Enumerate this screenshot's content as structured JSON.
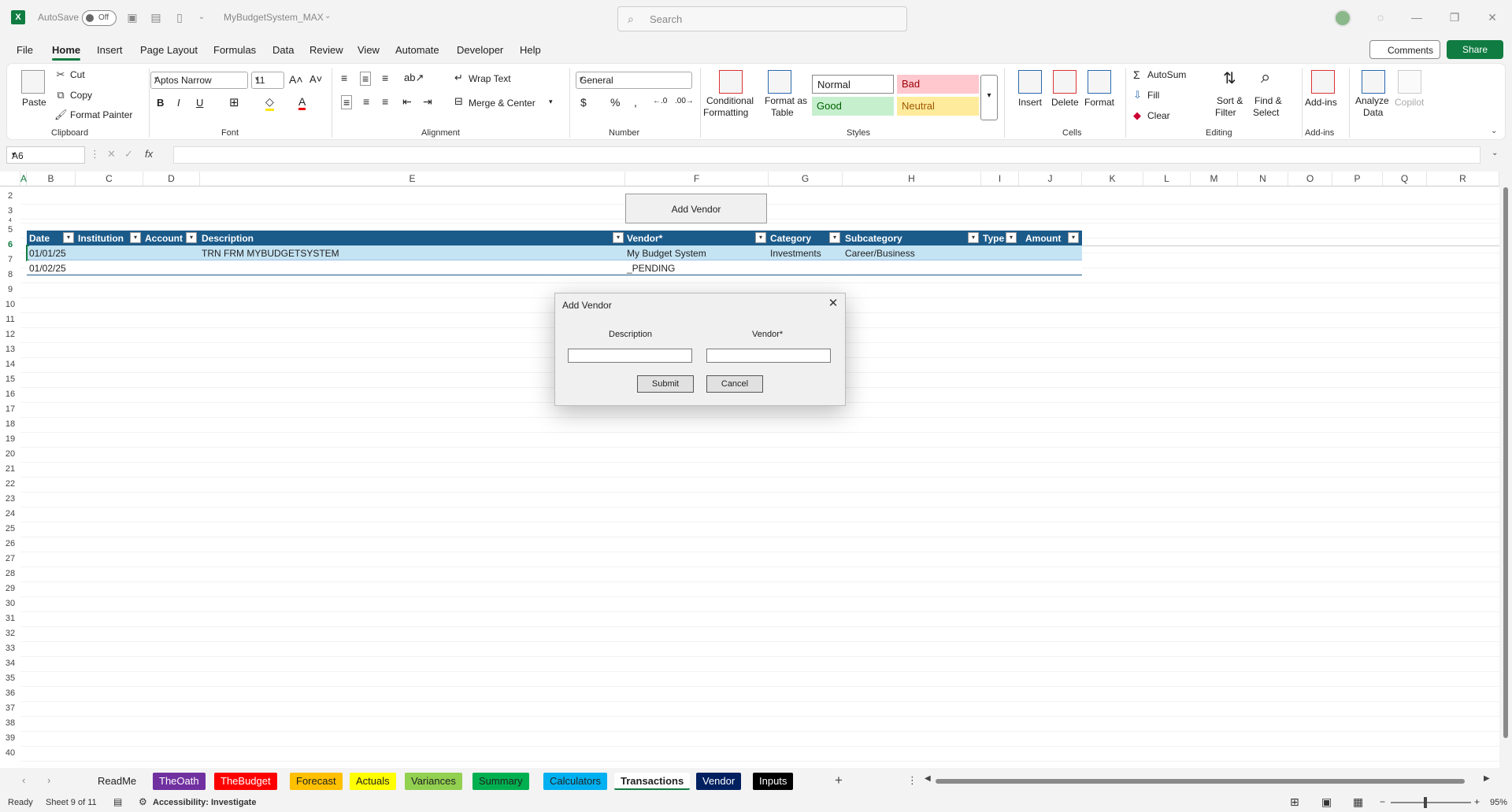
{
  "titlebar": {
    "autosave_label": "AutoSave",
    "autosave_state": "Off",
    "filename": "MyBudgetSystem_MAX",
    "search_placeholder": "Search"
  },
  "menu": {
    "items": [
      "File",
      "Home",
      "Insert",
      "Page Layout",
      "Formulas",
      "Data",
      "Review",
      "View",
      "Automate",
      "Developer",
      "Help"
    ],
    "active": "Home",
    "comments": "Comments",
    "share": "Share"
  },
  "ribbon": {
    "clipboard": {
      "paste": "Paste",
      "cut": "Cut",
      "copy": "Copy",
      "format_painter": "Format Painter",
      "label": "Clipboard"
    },
    "font": {
      "name": "Aptos Narrow",
      "size": "11",
      "label": "Font"
    },
    "alignment": {
      "wrap": "Wrap Text",
      "merge": "Merge & Center",
      "label": "Alignment"
    },
    "number": {
      "format": "General",
      "label": "Number"
    },
    "styles": {
      "conditional": "Conditional",
      "conditional2": "Formatting",
      "format_as": "Format as",
      "format_as2": "Table",
      "normal": "Normal",
      "bad": "Bad",
      "good": "Good",
      "neutral": "Neutral",
      "label": "Styles"
    },
    "cells": {
      "insert": "Insert",
      "delete": "Delete",
      "format": "Format",
      "label": "Cells"
    },
    "editing": {
      "autosum": "AutoSum",
      "fill": "Fill",
      "clear": "Clear",
      "sort": "Sort &",
      "sort2": "Filter",
      "find": "Find &",
      "find2": "Select",
      "label": "Editing"
    },
    "addins": {
      "addins": "Add-ins",
      "analyze": "Analyze",
      "analyze2": "Data",
      "copilot": "Copilot",
      "label": "Add-ins"
    }
  },
  "formula": {
    "cell_ref": "A6",
    "fx": "fx",
    "value": ""
  },
  "columns": [
    "A",
    "B",
    "C",
    "D",
    "E",
    "F",
    "G",
    "H",
    "I",
    "J",
    "K",
    "L",
    "M",
    "N",
    "O",
    "P",
    "Q",
    "R"
  ],
  "rows": [
    "2",
    "3",
    "4",
    "5",
    "6",
    "7",
    "8",
    "9",
    "10",
    "11",
    "12",
    "13",
    "14",
    "15",
    "16",
    "17",
    "18",
    "19",
    "20",
    "21",
    "22",
    "23",
    "24",
    "25",
    "26",
    "27",
    "28",
    "29",
    "30",
    "31",
    "32",
    "33",
    "34",
    "35",
    "36",
    "37",
    "38",
    "39",
    "40"
  ],
  "sheet_button": "Add Vendor",
  "table": {
    "headers": [
      "Date",
      "Institution",
      "Account",
      "Description",
      "Vendor*",
      "Category",
      "Subcategory",
      "Type",
      "Amount"
    ],
    "rows": [
      [
        "01/01/25",
        "",
        "",
        "TRN FRM MYBUDGETSYSTEM",
        "My Budget System",
        "Investments",
        "Career/Business",
        "",
        ""
      ],
      [
        "01/02/25",
        "",
        "",
        "",
        "_PENDING",
        "",
        "",
        "",
        ""
      ]
    ]
  },
  "dialog": {
    "title": "Add Vendor",
    "description_label": "Description",
    "vendor_label": "Vendor*",
    "description_value": "",
    "vendor_value": "",
    "submit": "Submit",
    "cancel": "Cancel"
  },
  "sheets": [
    {
      "name": "ReadMe",
      "color": "#f3f3f3",
      "text": "#222"
    },
    {
      "name": "TheOath",
      "color": "#7030a0",
      "text": "#fff"
    },
    {
      "name": "TheBudget",
      "color": "#ff0000",
      "text": "#fff"
    },
    {
      "name": "Forecast",
      "color": "#ffc000",
      "text": "#222"
    },
    {
      "name": "Actuals",
      "color": "#ffff00",
      "text": "#222"
    },
    {
      "name": "Variances",
      "color": "#92d050",
      "text": "#222"
    },
    {
      "name": "Summary",
      "color": "#00b050",
      "text": "#222"
    },
    {
      "name": "Calculators",
      "color": "#00b0f0",
      "text": "#222"
    },
    {
      "name": "Transactions",
      "color": "#f3f3f3",
      "text": "#222"
    },
    {
      "name": "Vendor",
      "color": "#002060",
      "text": "#fff"
    },
    {
      "name": "Inputs",
      "color": "#000000",
      "text": "#fff"
    }
  ],
  "active_sheet": "Transactions",
  "status": {
    "ready": "Ready",
    "sheet": "Sheet 9 of 11",
    "accessibility": "Accessibility: Investigate",
    "zoom": "95%"
  }
}
